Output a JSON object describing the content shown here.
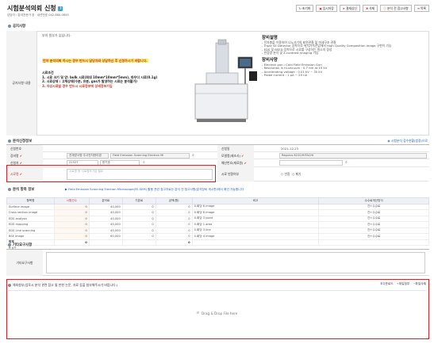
{
  "page": {
    "title": "시험분석의뢰 신청",
    "subinfo": "담당자 : 분석전문가 장 · 내선번호 042-860-0655",
    "toolbar": [
      {
        "label": "초기화",
        "icon": "refresh-icon"
      },
      {
        "label": "임시저장",
        "icon": "save-icon"
      },
      {
        "label": "결재상신",
        "icon": "send-icon"
      },
      {
        "label": "삭제",
        "icon": "trash-icon"
      },
      {
        "label": "분석 전 참고사항",
        "icon": "info-icon"
      },
      {
        "label": "목록",
        "icon": "list-icon"
      }
    ]
  },
  "notice": {
    "section_title": "공지사항",
    "label": "공지사항 내용",
    "first_line": "부의 원부가 없습니다.",
    "highlight": "먼저 분석의뢰 하시는 경우 반드시 담당자와 상담하신 후 신청하시기 바랍니다.",
    "cond_title": "시료조건",
    "cond_lines": [
      "1. 시료 크기 및 양: bulk 시료(최대 10mm*10mm*5mm), 파우더 시료(0.1g)",
      "2. 시료상태 : 고체상태(수분, 유분, gas가 발생하는 시료는 분석불가)"
    ],
    "cond_red": "3. 자성시료일 경우 반드시 시료정보에 상세정보기입",
    "equip": {
      "h1": "장비설명",
      "desc_lines": [
        "- 전자총을 이용하여 나노크기의 표면관찰 및 미세구조 관찰",
        "- Triple SE Detector 장착으로 위치가속전압에서 High Quality Composition image 구현이 가능",
        "- EDS 및 BSED 장착으로 시료를 구성하는 원소의 정성",
        "- 반정량 분석 및 Z-contrast imaging 가능"
      ],
      "h2": "장비사양",
      "spec_lines": [
        "- Electron gun : Cold Field Emission Gun",
        "- Resolution in hi-vacuum : 0.7 nm at 15 kV",
        "- Accelerating voltage : 0.01 kV ~ 30 kV",
        "- Probe current : 1 pA ~ 20 nA"
      ]
    }
  },
  "request": {
    "section_title": "분석신청정보",
    "right_link": "시험분석 접수현황(법정)으로",
    "rows": [
      {
        "l1": "신청번호",
        "v1": "",
        "l2": "신청일",
        "v2": "2021-12-23"
      },
      {
        "l1": "장비명",
        "v1a": "전계방사형 주사전자현미경",
        "v1b": "Field Emission Scanning Electron Mi",
        "l2": "모델명(제조사)",
        "v2": "Regulus 8220/HITACHI"
      },
      {
        "l1": "신청자",
        "v1a": "21527",
        "v1b": "한기호",
        "l2": "예산번호(재료원)",
        "v2": ""
      },
      {
        "l1": "시료명",
        "v1": "시료명 등 시료정보기입 필요",
        "l2": "시료 반환여부",
        "v2a": "반환",
        "v2b": "폐기"
      }
    ]
  },
  "items": {
    "section_title": "분석 항목 정보",
    "link_text": "Field Emission Scanning Electron Microscope(FE-SEM) 활용 관련 참고자료는 분석 전 참고사항(분석장비 게시판)에서 확인 가능합니다",
    "headers": [
      "항목명",
      "시험건수",
      "분석료",
      "기본료",
      "금액(원)",
      "비고",
      "수수료개산방식"
    ],
    "rows": [
      [
        "Surface image",
        "0",
        "40,000",
        "0",
        "0",
        "0.회당 6 image",
        "건+수수료"
      ],
      [
        "Cross section image",
        "0",
        "40,000",
        "0",
        "0",
        "0.회당 6 image",
        "건+수수료"
      ],
      [
        "EDS analysis",
        "0",
        "40,000",
        "0",
        "0",
        "0.회당 3 point",
        "건+수수료"
      ],
      [
        "EDS mapping",
        "0",
        "40,000",
        "0",
        "0",
        "0.회당 1 area",
        "건+수수료"
      ],
      [
        "EDS Line scanning",
        "0",
        "40,000",
        "0",
        "0",
        "0.회당 3 line",
        "건+수수료"
      ],
      [
        "BSE image",
        "0",
        "60,000",
        "0",
        "0",
        "0.회당 4 image",
        "건+수수료"
      ]
    ],
    "sum_label": "합계",
    "sum_count": "0",
    "sum_amount": "0",
    "total_label": "총 6건"
  },
  "other": {
    "section_title": "기타요구사항",
    "label": "기타요구사항"
  },
  "attach": {
    "header": "해외첨부(업로시 분석 관련 참고 될 만한 논문, 자료 등을 첨부해주시기 바랍니다.)",
    "btn_download": "다운로드",
    "btn_add": "파일첨부",
    "btn_delete": "파일삭제",
    "drop_text": "Drag & Drop File here"
  },
  "colors": {
    "required_red": "#c0392b",
    "highlight": "#fff26b",
    "annotation_red": "#e02020"
  }
}
